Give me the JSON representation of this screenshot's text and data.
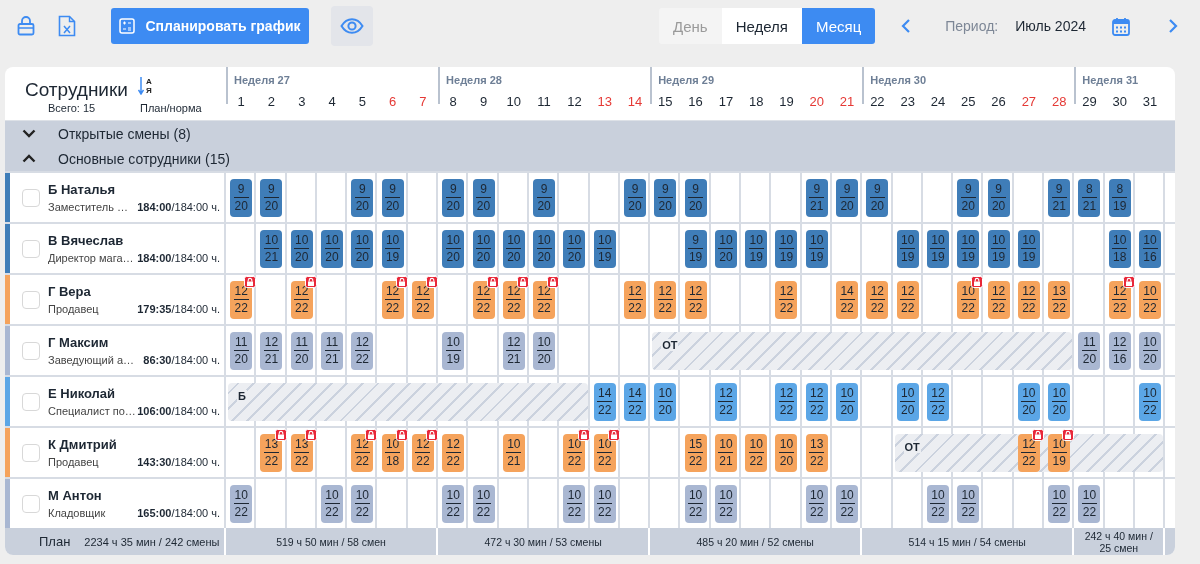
{
  "toolbar": {
    "plan_button": "Спланировать график"
  },
  "view_switch": [
    {
      "label": "День",
      "selected": false,
      "disabled": true
    },
    {
      "label": "Неделя",
      "selected": false,
      "disabled": false
    },
    {
      "label": "Месяц",
      "selected": true,
      "disabled": false
    }
  ],
  "period": {
    "label": "Период:",
    "value": "Июль 2024"
  },
  "staff_header": {
    "title": "Сотрудники",
    "sort": {
      "from": "А",
      "to": "Я"
    },
    "total": "Всего: 15",
    "hours_caption": "План/норма"
  },
  "weeks": [
    {
      "label": "Неделя 27",
      "total": "519 ч 50 мин / 58 смен",
      "days": [
        {
          "label": "1",
          "weekend": false
        },
        {
          "label": "2",
          "weekend": false
        },
        {
          "label": "3",
          "weekend": false
        },
        {
          "label": "4",
          "weekend": false
        },
        {
          "label": "5",
          "weekend": false
        },
        {
          "label": "6",
          "weekend": true
        },
        {
          "label": "7",
          "weekend": true
        }
      ]
    },
    {
      "label": "Неделя 28",
      "total": "472 ч 30 мин / 53 смены",
      "days": [
        {
          "label": "8",
          "weekend": false
        },
        {
          "label": "9",
          "weekend": false
        },
        {
          "label": "10",
          "weekend": false
        },
        {
          "label": "11",
          "weekend": false
        },
        {
          "label": "12",
          "weekend": false
        },
        {
          "label": "13",
          "weekend": true
        },
        {
          "label": "14",
          "weekend": true
        }
      ]
    },
    {
      "label": "Неделя 29",
      "total": "485 ч 20 мин / 52 смены",
      "days": [
        {
          "label": "15",
          "weekend": false
        },
        {
          "label": "16",
          "weekend": false
        },
        {
          "label": "17",
          "weekend": false
        },
        {
          "label": "18",
          "weekend": false
        },
        {
          "label": "19",
          "weekend": false
        },
        {
          "label": "20",
          "weekend": true
        },
        {
          "label": "21",
          "weekend": true
        }
      ]
    },
    {
      "label": "Неделя 30",
      "total": "514 ч 15 мин / 54 смены",
      "days": [
        {
          "label": "22",
          "weekend": false
        },
        {
          "label": "23",
          "weekend": false
        },
        {
          "label": "24",
          "weekend": false
        },
        {
          "label": "25",
          "weekend": false
        },
        {
          "label": "26",
          "weekend": false
        },
        {
          "label": "27",
          "weekend": true
        },
        {
          "label": "28",
          "weekend": true
        }
      ]
    },
    {
      "label": "Неделя 31",
      "total": "242 ч 40 мин / 25 смен",
      "days": [
        {
          "label": "29",
          "weekend": false
        },
        {
          "label": "30",
          "weekend": false
        },
        {
          "label": "31",
          "weekend": false
        }
      ]
    }
  ],
  "groups": [
    {
      "label": "Открытые смены (8)",
      "expanded": false
    },
    {
      "label": "Основные сотрудники (15)",
      "expanded": true,
      "employees": [
        {
          "name": "Б Наталья",
          "position": "Заместитель …",
          "hours": "**184:00**/184:00 ч.",
          "color": "#3f7db8",
          "checked": false,
          "cells": [
            {
              "kind": "shift",
              "start": "9",
              "end": "20",
              "locked": false
            },
            {
              "kind": "shift",
              "start": "9",
              "end": "20",
              "locked": false
            },
            {
              "kind": "empty"
            },
            {
              "kind": "empty"
            },
            {
              "kind": "shift",
              "start": "9",
              "end": "20",
              "locked": false
            },
            {
              "kind": "shift",
              "start": "9",
              "end": "20",
              "locked": false
            },
            {
              "kind": "empty"
            },
            {
              "kind": "shift",
              "start": "9",
              "end": "20",
              "locked": false
            },
            {
              "kind": "shift",
              "start": "9",
              "end": "20",
              "locked": false
            },
            {
              "kind": "empty"
            },
            {
              "kind": "shift",
              "start": "9",
              "end": "20",
              "locked": false
            },
            {
              "kind": "empty"
            },
            {
              "kind": "empty"
            },
            {
              "kind": "shift",
              "start": "9",
              "end": "20",
              "locked": false
            },
            {
              "kind": "shift",
              "start": "9",
              "end": "20",
              "locked": false
            },
            {
              "kind": "shift",
              "start": "9",
              "end": "20",
              "locked": false
            },
            {
              "kind": "empty"
            },
            {
              "kind": "empty"
            },
            {
              "kind": "empty"
            },
            {
              "kind": "shift",
              "start": "9",
              "end": "21",
              "locked": false
            },
            {
              "kind": "shift",
              "start": "9",
              "end": "20",
              "locked": false
            },
            {
              "kind": "shift",
              "start": "9",
              "end": "20",
              "locked": false
            },
            {
              "kind": "empty"
            },
            {
              "kind": "empty"
            },
            {
              "kind": "shift",
              "start": "9",
              "end": "20",
              "locked": false
            },
            {
              "kind": "shift",
              "start": "9",
              "end": "20",
              "locked": false
            },
            {
              "kind": "empty"
            },
            {
              "kind": "shift",
              "start": "9",
              "end": "21",
              "locked": false
            },
            {
              "kind": "shift",
              "start": "8",
              "end": "21",
              "locked": false
            },
            {
              "kind": "shift",
              "start": "8",
              "end": "19",
              "locked": false
            },
            {
              "kind": "empty"
            }
          ]
        },
        {
          "name": "В Вячеслав",
          "position": "Директор мага…",
          "hours": "**184:00**/184:00 ч.",
          "color": "#3f7db8",
          "checked": false,
          "cells": [
            {
              "kind": "empty"
            },
            {
              "kind": "shift",
              "start": "10",
              "end": "21",
              "locked": false
            },
            {
              "kind": "shift",
              "start": "10",
              "end": "20",
              "locked": false
            },
            {
              "kind": "shift",
              "start": "10",
              "end": "20",
              "locked": false
            },
            {
              "kind": "shift",
              "start": "10",
              "end": "20",
              "locked": false
            },
            {
              "kind": "shift",
              "start": "10",
              "end": "19",
              "locked": false
            },
            {
              "kind": "empty"
            },
            {
              "kind": "shift",
              "start": "10",
              "end": "20",
              "locked": false
            },
            {
              "kind": "shift",
              "start": "10",
              "end": "20",
              "locked": false
            },
            {
              "kind": "shift",
              "start": "10",
              "end": "20",
              "locked": false
            },
            {
              "kind": "shift",
              "start": "10",
              "end": "20",
              "locked": false
            },
            {
              "kind": "shift",
              "start": "10",
              "end": "20",
              "locked": false
            },
            {
              "kind": "shift",
              "start": "10",
              "end": "19",
              "locked": false
            },
            {
              "kind": "empty"
            },
            {
              "kind": "empty"
            },
            {
              "kind": "shift",
              "start": "9",
              "end": "19",
              "locked": false
            },
            {
              "kind": "shift",
              "start": "10",
              "end": "20",
              "locked": false
            },
            {
              "kind": "shift",
              "start": "10",
              "end": "19",
              "locked": false
            },
            {
              "kind": "shift",
              "start": "10",
              "end": "19",
              "locked": false
            },
            {
              "kind": "shift",
              "start": "10",
              "end": "19",
              "locked": false
            },
            {
              "kind": "empty"
            },
            {
              "kind": "empty"
            },
            {
              "kind": "shift",
              "start": "10",
              "end": "19",
              "locked": false
            },
            {
              "kind": "shift",
              "start": "10",
              "end": "19",
              "locked": false
            },
            {
              "kind": "shift",
              "start": "10",
              "end": "19",
              "locked": false
            },
            {
              "kind": "shift",
              "start": "10",
              "end": "19",
              "locked": false
            },
            {
              "kind": "shift",
              "start": "10",
              "end": "19",
              "locked": false
            },
            {
              "kind": "empty"
            },
            {
              "kind": "empty"
            },
            {
              "kind": "shift",
              "start": "10",
              "end": "18",
              "locked": false
            },
            {
              "kind": "shift",
              "start": "10",
              "end": "16",
              "locked": false
            }
          ]
        },
        {
          "name": "Г Вера",
          "position": "Продавец",
          "hours": "**179:35**/184:00 ч.",
          "color": "#f5a35c",
          "checked": false,
          "cells": [
            {
              "kind": "shift",
              "start": "12",
              "end": "22",
              "locked": true
            },
            {
              "kind": "empty"
            },
            {
              "kind": "shift",
              "start": "12",
              "end": "22",
              "locked": true
            },
            {
              "kind": "empty"
            },
            {
              "kind": "empty"
            },
            {
              "kind": "shift",
              "start": "12",
              "end": "22",
              "locked": true
            },
            {
              "kind": "shift",
              "start": "12",
              "end": "22",
              "locked": true
            },
            {
              "kind": "empty"
            },
            {
              "kind": "shift",
              "start": "12",
              "end": "22",
              "locked": true
            },
            {
              "kind": "shift",
              "start": "12",
              "end": "22",
              "locked": true
            },
            {
              "kind": "shift",
              "start": "12",
              "end": "22",
              "locked": true
            },
            {
              "kind": "empty"
            },
            {
              "kind": "empty"
            },
            {
              "kind": "shift",
              "start": "12",
              "end": "22",
              "locked": false
            },
            {
              "kind": "shift",
              "start": "12",
              "end": "22",
              "locked": false
            },
            {
              "kind": "shift",
              "start": "12",
              "end": "22",
              "locked": false
            },
            {
              "kind": "empty"
            },
            {
              "kind": "empty"
            },
            {
              "kind": "shift",
              "start": "12",
              "end": "22",
              "locked": false
            },
            {
              "kind": "empty"
            },
            {
              "kind": "shift",
              "start": "14",
              "end": "22",
              "locked": false
            },
            {
              "kind": "shift",
              "start": "12",
              "end": "22",
              "locked": false
            },
            {
              "kind": "shift",
              "start": "12",
              "end": "22",
              "locked": false
            },
            {
              "kind": "empty"
            },
            {
              "kind": "shift",
              "start": "10",
              "end": "22",
              "locked": true
            },
            {
              "kind": "shift",
              "start": "12",
              "end": "22",
              "locked": false
            },
            {
              "kind": "shift",
              "start": "12",
              "end": "22",
              "locked": false
            },
            {
              "kind": "shift",
              "start": "13",
              "end": "22",
              "locked": false
            },
            {
              "kind": "empty"
            },
            {
              "kind": "shift",
              "start": "12",
              "end": "22",
              "locked": true
            },
            {
              "kind": "shift",
              "start": "10",
              "end": "22",
              "locked": false
            }
          ]
        },
        {
          "name": "Г Максим",
          "position": "Заведующий а…",
          "hours": "**86:30**/184:00 ч.",
          "color": "#a9b7d2",
          "checked": false,
          "cells": [
            {
              "kind": "shift",
              "start": "11",
              "end": "20",
              "locked": false
            },
            {
              "kind": "shift",
              "start": "12",
              "end": "21",
              "locked": false
            },
            {
              "kind": "shift",
              "start": "11",
              "end": "20",
              "locked": false
            },
            {
              "kind": "shift",
              "start": "11",
              "end": "21",
              "locked": false
            },
            {
              "kind": "shift",
              "start": "12",
              "end": "22",
              "locked": false
            },
            {
              "kind": "empty"
            },
            {
              "kind": "empty"
            },
            {
              "kind": "shift",
              "start": "10",
              "end": "19",
              "locked": false
            },
            {
              "kind": "empty"
            },
            {
              "kind": "shift",
              "start": "12",
              "end": "21",
              "locked": false
            },
            {
              "kind": "shift",
              "start": "10",
              "end": "20",
              "locked": false
            },
            {
              "kind": "empty"
            },
            {
              "kind": "empty"
            },
            {
              "kind": "empty"
            },
            {
              "kind": "absence",
              "label": "ОТ"
            },
            {
              "kind": "absence"
            },
            {
              "kind": "absence"
            },
            {
              "kind": "absence"
            },
            {
              "kind": "absence"
            },
            {
              "kind": "absence"
            },
            {
              "kind": "absence"
            },
            {
              "kind": "absence"
            },
            {
              "kind": "absence"
            },
            {
              "kind": "absence"
            },
            {
              "kind": "absence"
            },
            {
              "kind": "absence"
            },
            {
              "kind": "absence"
            },
            {
              "kind": "absence"
            },
            {
              "kind": "shift",
              "start": "11",
              "end": "20",
              "locked": false
            },
            {
              "kind": "shift",
              "start": "12",
              "end": "16",
              "locked": false
            },
            {
              "kind": "shift",
              "start": "10",
              "end": "20",
              "locked": false
            }
          ]
        },
        {
          "name": "Е Николай",
          "position": "Специалист по…",
          "hours": "**106:00**/184:00 ч.",
          "color": "#5ba6e6",
          "checked": false,
          "cells": [
            {
              "kind": "absence",
              "label": "Б"
            },
            {
              "kind": "absence"
            },
            {
              "kind": "absence"
            },
            {
              "kind": "absence"
            },
            {
              "kind": "absence"
            },
            {
              "kind": "absence"
            },
            {
              "kind": "absence"
            },
            {
              "kind": "absence"
            },
            {
              "kind": "absence"
            },
            {
              "kind": "absence"
            },
            {
              "kind": "absence"
            },
            {
              "kind": "absence"
            },
            {
              "kind": "shift",
              "start": "14",
              "end": "22",
              "locked": false
            },
            {
              "kind": "shift",
              "start": "14",
              "end": "22",
              "locked": false
            },
            {
              "kind": "shift",
              "start": "10",
              "end": "20",
              "locked": false
            },
            {
              "kind": "empty"
            },
            {
              "kind": "shift",
              "start": "12",
              "end": "22",
              "locked": false
            },
            {
              "kind": "empty"
            },
            {
              "kind": "shift",
              "start": "12",
              "end": "22",
              "locked": false
            },
            {
              "kind": "shift",
              "start": "12",
              "end": "22",
              "locked": false
            },
            {
              "kind": "shift",
              "start": "10",
              "end": "20",
              "locked": false
            },
            {
              "kind": "empty"
            },
            {
              "kind": "shift",
              "start": "10",
              "end": "20",
              "locked": false
            },
            {
              "kind": "shift",
              "start": "12",
              "end": "22",
              "locked": false
            },
            {
              "kind": "empty"
            },
            {
              "kind": "empty"
            },
            {
              "kind": "shift",
              "start": "10",
              "end": "20",
              "locked": false
            },
            {
              "kind": "shift",
              "start": "10",
              "end": "20",
              "locked": false
            },
            {
              "kind": "empty"
            },
            {
              "kind": "empty"
            },
            {
              "kind": "shift",
              "start": "10",
              "end": "22",
              "locked": false
            }
          ]
        },
        {
          "name": "К Дмитрий",
          "position": "Продавец",
          "hours": "**143:30**/184:00 ч.",
          "color": "#f5a35c",
          "checked": false,
          "cells": [
            {
              "kind": "empty"
            },
            {
              "kind": "shift",
              "start": "13",
              "end": "22",
              "locked": true
            },
            {
              "kind": "shift",
              "start": "13",
              "end": "22",
              "locked": true
            },
            {
              "kind": "empty"
            },
            {
              "kind": "shift",
              "start": "12",
              "end": "22",
              "locked": true
            },
            {
              "kind": "shift",
              "start": "10",
              "end": "18",
              "locked": true
            },
            {
              "kind": "shift",
              "start": "12",
              "end": "22",
              "locked": true
            },
            {
              "kind": "shift",
              "start": "12",
              "end": "22",
              "locked": false
            },
            {
              "kind": "empty"
            },
            {
              "kind": "shift",
              "start": "10",
              "end": "21",
              "locked": false
            },
            {
              "kind": "empty"
            },
            {
              "kind": "shift",
              "start": "10",
              "end": "22",
              "locked": true
            },
            {
              "kind": "shift",
              "start": "10",
              "end": "22",
              "locked": true
            },
            {
              "kind": "empty"
            },
            {
              "kind": "empty"
            },
            {
              "kind": "shift",
              "start": "15",
              "end": "22",
              "locked": false
            },
            {
              "kind": "shift",
              "start": "10",
              "end": "21",
              "locked": false
            },
            {
              "kind": "shift",
              "start": "10",
              "end": "22",
              "locked": false
            },
            {
              "kind": "shift",
              "start": "10",
              "end": "20",
              "locked": false
            },
            {
              "kind": "shift",
              "start": "13",
              "end": "22",
              "locked": false
            },
            {
              "kind": "empty"
            },
            {
              "kind": "empty"
            },
            {
              "kind": "absence",
              "label": "ОТ"
            },
            {
              "kind": "absence"
            },
            {
              "kind": "absence"
            },
            {
              "kind": "absence"
            },
            {
              "kind": "absence",
              "shift": {
                "start": "12",
                "end": "22",
                "locked": true
              }
            },
            {
              "kind": "absence",
              "shift": {
                "start": "10",
                "end": "19",
                "locked": true
              }
            },
            {
              "kind": "absence"
            },
            {
              "kind": "absence"
            },
            {
              "kind": "absence"
            }
          ]
        },
        {
          "name": "М Антон",
          "position": "Кладовщик",
          "hours": "**165:00**/184:00 ч.",
          "color": "#a9b7d2",
          "checked": false,
          "cells": [
            {
              "kind": "shift",
              "start": "10",
              "end": "22",
              "locked": false
            },
            {
              "kind": "empty"
            },
            {
              "kind": "empty"
            },
            {
              "kind": "shift",
              "start": "10",
              "end": "22",
              "locked": false
            },
            {
              "kind": "shift",
              "start": "10",
              "end": "22",
              "locked": false
            },
            {
              "kind": "empty"
            },
            {
              "kind": "empty"
            },
            {
              "kind": "shift",
              "start": "10",
              "end": "22",
              "locked": false
            },
            {
              "kind": "shift",
              "start": "10",
              "end": "22",
              "locked": false
            },
            {
              "kind": "empty"
            },
            {
              "kind": "empty"
            },
            {
              "kind": "shift",
              "start": "10",
              "end": "22",
              "locked": false
            },
            {
              "kind": "shift",
              "start": "10",
              "end": "22",
              "locked": false
            },
            {
              "kind": "empty"
            },
            {
              "kind": "empty"
            },
            {
              "kind": "shift",
              "start": "10",
              "end": "22",
              "locked": false
            },
            {
              "kind": "shift",
              "start": "10",
              "end": "22",
              "locked": false
            },
            {
              "kind": "empty"
            },
            {
              "kind": "empty"
            },
            {
              "kind": "shift",
              "start": "10",
              "end": "22",
              "locked": false
            },
            {
              "kind": "shift",
              "start": "10",
              "end": "22",
              "locked": false
            },
            {
              "kind": "empty"
            },
            {
              "kind": "empty"
            },
            {
              "kind": "shift",
              "start": "10",
              "end": "22",
              "locked": false
            },
            {
              "kind": "shift",
              "start": "10",
              "end": "22",
              "locked": false
            },
            {
              "kind": "empty"
            },
            {
              "kind": "empty"
            },
            {
              "kind": "shift",
              "start": "10",
              "end": "22",
              "locked": false
            },
            {
              "kind": "shift",
              "start": "10",
              "end": "22",
              "locked": false
            },
            {
              "kind": "empty"
            },
            {
              "kind": "empty"
            }
          ]
        }
      ]
    }
  ],
  "footer": {
    "label": "План",
    "total": "2234 ч 35 мин / 242 смены"
  }
}
